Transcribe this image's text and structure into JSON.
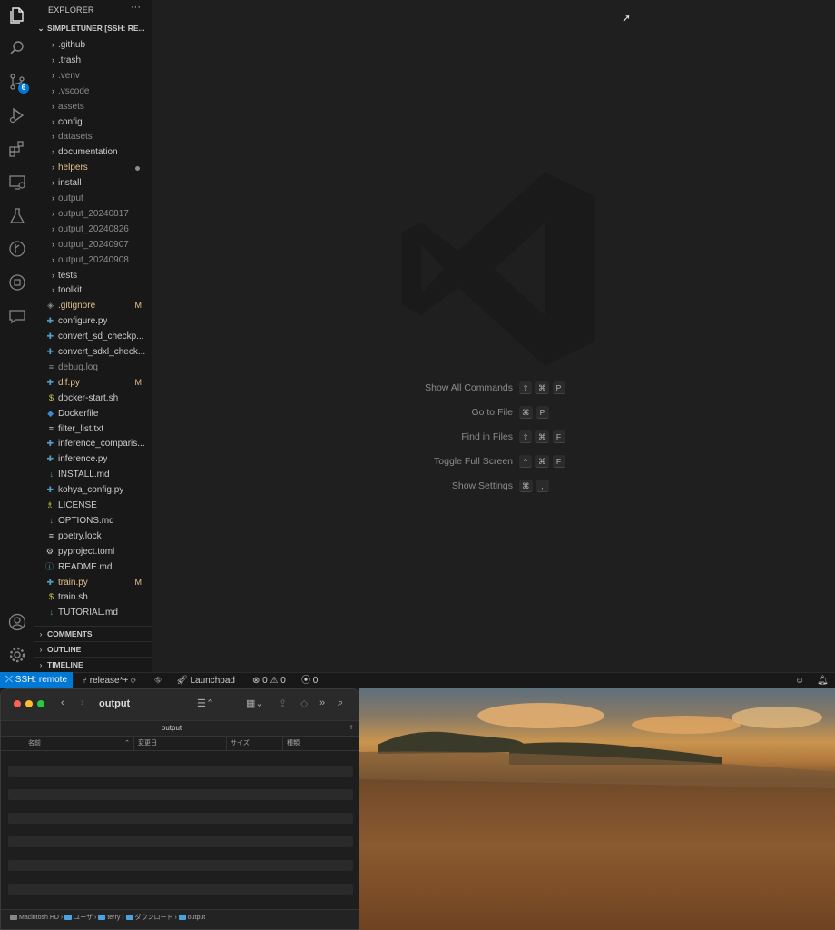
{
  "explorer": {
    "title": "EXPLORER",
    "more": "···",
    "workspace": "SIMPLETUNER [SSH: RE...",
    "items": [
      {
        "name": ".github",
        "kind": "folder",
        "style": "normal"
      },
      {
        "name": ".trash",
        "kind": "folder",
        "style": "normal"
      },
      {
        "name": ".venv",
        "kind": "folder",
        "style": "dim"
      },
      {
        "name": ".vscode",
        "kind": "folder",
        "style": "dim"
      },
      {
        "name": "assets",
        "kind": "folder",
        "style": "dim"
      },
      {
        "name": "config",
        "kind": "folder",
        "style": "normal"
      },
      {
        "name": "datasets",
        "kind": "folder",
        "style": "dim"
      },
      {
        "name": "documentation",
        "kind": "folder",
        "style": "normal"
      },
      {
        "name": "helpers",
        "kind": "folder",
        "style": "mod",
        "dot": true
      },
      {
        "name": "install",
        "kind": "folder",
        "style": "normal"
      },
      {
        "name": "output",
        "kind": "folder",
        "style": "dim"
      },
      {
        "name": "output_20240817",
        "kind": "folder",
        "style": "dim"
      },
      {
        "name": "output_20240826",
        "kind": "folder",
        "style": "dim"
      },
      {
        "name": "output_20240907",
        "kind": "folder",
        "style": "dim"
      },
      {
        "name": "output_20240908",
        "kind": "folder",
        "style": "dim"
      },
      {
        "name": "tests",
        "kind": "folder",
        "style": "normal"
      },
      {
        "name": "toolkit",
        "kind": "folder",
        "style": "normal"
      },
      {
        "name": ".gitignore",
        "kind": "file",
        "icon": "◈",
        "iconColor": "#8b8b8b",
        "style": "mod",
        "status": "M"
      },
      {
        "name": "configure.py",
        "kind": "file",
        "icon": "✚",
        "iconColor": "#4f9fc4",
        "style": "normal"
      },
      {
        "name": "convert_sd_checkp...",
        "kind": "file",
        "icon": "✚",
        "iconColor": "#4f9fc4",
        "style": "normal"
      },
      {
        "name": "convert_sdxl_check...",
        "kind": "file",
        "icon": "✚",
        "iconColor": "#4f9fc4",
        "style": "normal"
      },
      {
        "name": "debug.log",
        "kind": "file",
        "icon": "≡",
        "iconColor": "#8b8b8b",
        "style": "dim"
      },
      {
        "name": "dif.py",
        "kind": "file",
        "icon": "✚",
        "iconColor": "#4f9fc4",
        "style": "mod",
        "status": "M"
      },
      {
        "name": "docker-start.sh",
        "kind": "file",
        "icon": "$",
        "iconColor": "#c9c94f",
        "style": "normal"
      },
      {
        "name": "Dockerfile",
        "kind": "file",
        "icon": "◆",
        "iconColor": "#3a8ccf",
        "style": "normal"
      },
      {
        "name": "filter_list.txt",
        "kind": "file",
        "icon": "≡",
        "iconColor": "#cccccc",
        "style": "normal"
      },
      {
        "name": "inference_comparis...",
        "kind": "file",
        "icon": "✚",
        "iconColor": "#4f9fc4",
        "style": "normal"
      },
      {
        "name": "inference.py",
        "kind": "file",
        "icon": "✚",
        "iconColor": "#4f9fc4",
        "style": "normal"
      },
      {
        "name": "INSTALL.md",
        "kind": "file",
        "icon": "↓",
        "iconColor": "#519aba",
        "style": "normal"
      },
      {
        "name": "kohya_config.py",
        "kind": "file",
        "icon": "✚",
        "iconColor": "#4f9fc4",
        "style": "normal"
      },
      {
        "name": "LICENSE",
        "kind": "file",
        "icon": "♗",
        "iconColor": "#cbcb41",
        "style": "normal"
      },
      {
        "name": "OPTIONS.md",
        "kind": "file",
        "icon": "↓",
        "iconColor": "#519aba",
        "style": "normal"
      },
      {
        "name": "poetry.lock",
        "kind": "file",
        "icon": "≡",
        "iconColor": "#cccccc",
        "style": "normal"
      },
      {
        "name": "pyproject.toml",
        "kind": "file",
        "icon": "⚙",
        "iconColor": "#cccccc",
        "style": "normal"
      },
      {
        "name": "README.md",
        "kind": "file",
        "icon": "ⓘ",
        "iconColor": "#519aba",
        "style": "normal"
      },
      {
        "name": "train.py",
        "kind": "file",
        "icon": "✚",
        "iconColor": "#4f9fc4",
        "style": "mod",
        "status": "M"
      },
      {
        "name": "train.sh",
        "kind": "file",
        "icon": "$",
        "iconColor": "#c9c94f",
        "style": "normal"
      },
      {
        "name": "TUTORIAL.md",
        "kind": "file",
        "icon": "↓",
        "iconColor": "#519aba",
        "style": "normal"
      }
    ],
    "sections": [
      "COMMENTS",
      "OUTLINE",
      "TIMELINE"
    ]
  },
  "activity_bar": {
    "icons": [
      "files-icon",
      "search-icon",
      "source-control-icon",
      "run-debug-icon",
      "extensions-icon",
      "remote-explorer-icon",
      "testing-icon",
      "git-graph-icon",
      "docker-icon",
      "chat-icon"
    ],
    "scm_badge": "6",
    "bottom_icons": [
      "account-icon",
      "manage-gear-icon"
    ]
  },
  "editor": {
    "shortcuts": [
      {
        "label": "Show All Commands",
        "keys": [
          "⇧",
          "⌘",
          "P"
        ]
      },
      {
        "label": "Go to File",
        "keys": [
          "⌘",
          "P"
        ]
      },
      {
        "label": "Find in Files",
        "keys": [
          "⇧",
          "⌘",
          "F"
        ]
      },
      {
        "label": "Toggle Full Screen",
        "keys": [
          "^",
          "⌘",
          "F"
        ]
      },
      {
        "label": "Show Settings",
        "keys": [
          "⌘",
          ","
        ]
      }
    ]
  },
  "status_bar": {
    "remote": "SSH: remote",
    "branch": "release*+",
    "launchpad": "Launchpad",
    "errors": "0",
    "warnings": "0",
    "ports": "0"
  },
  "finder": {
    "title": "output",
    "tab": "output",
    "columns": [
      "名前",
      "変更日",
      "サイズ",
      "種類"
    ],
    "path": [
      "Macintosh HD",
      "ユーザ",
      "terry",
      "ダウンロード",
      "output"
    ]
  },
  "colors": {
    "accent": "#0078d4",
    "modified": "#e2c08d",
    "traffic_red": "#ff5f57",
    "traffic_yellow": "#febc2e",
    "traffic_green": "#28c840"
  }
}
